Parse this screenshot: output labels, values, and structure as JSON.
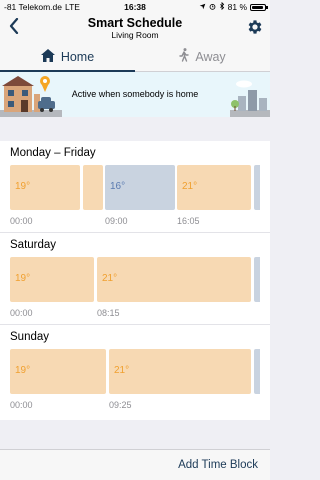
{
  "status_bar": {
    "carrier": "-81 Telekom.de",
    "network": "LTE",
    "time": "16:38",
    "battery": "81 %"
  },
  "nav": {
    "title": "Smart Schedule",
    "subtitle": "Living Room",
    "back_icon": "chevron-left-icon",
    "settings_icon": "gear-icon"
  },
  "tabs": [
    {
      "label": "Home",
      "icon": "house-icon",
      "active": true
    },
    {
      "label": "Away",
      "icon": "walking-person-icon",
      "active": false
    }
  ],
  "banner": {
    "text": "Active when somebody is home"
  },
  "schedules": [
    {
      "title": "Monday – Friday",
      "blocks": [
        {
          "label": "19°",
          "type": "warm"
        },
        {
          "label": "",
          "type": "warm"
        },
        {
          "label": "16°",
          "type": "cool"
        },
        {
          "label": "21°",
          "type": "warm"
        }
      ],
      "times": [
        "00:00",
        "09:00",
        "16:05"
      ]
    },
    {
      "title": "Saturday",
      "blocks": [
        {
          "label": "19°",
          "type": "warm"
        },
        {
          "label": "21°",
          "type": "warm"
        }
      ],
      "times": [
        "00:00",
        "08:15"
      ]
    },
    {
      "title": "Sunday",
      "blocks": [
        {
          "label": "19°",
          "type": "warm"
        },
        {
          "label": "21°",
          "type": "warm"
        }
      ],
      "times": [
        "00:00",
        "09:25"
      ]
    }
  ],
  "footer": {
    "add_button": "Add Time Block"
  },
  "colors": {
    "accent": "#1c3a57",
    "warm_block": "#f7d9b3",
    "warm_text": "#f0a030",
    "cool_block": "#c9d3e0",
    "cool_text": "#5b7bb0"
  }
}
